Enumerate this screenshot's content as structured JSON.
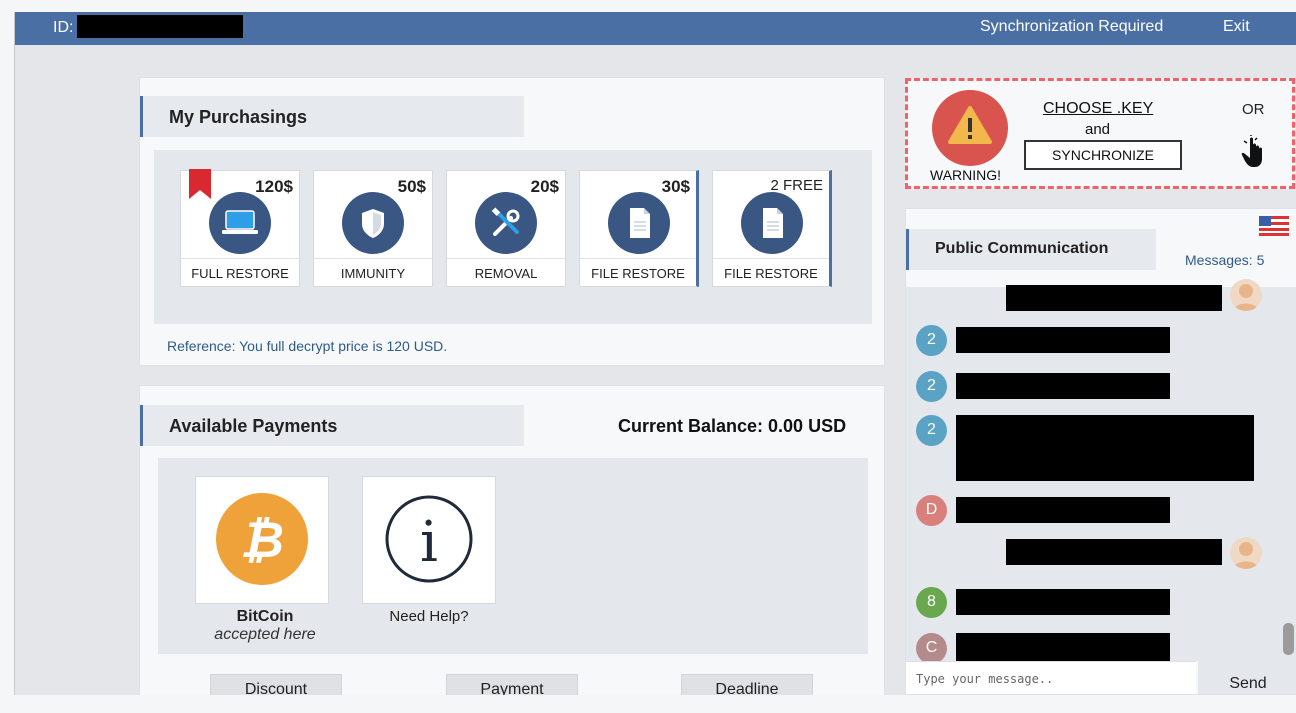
{
  "topbar": {
    "id_label": "ID:",
    "sync_link": "Synchronization Required",
    "exit_link": "Exit"
  },
  "purchasings": {
    "title": "My Purchasings",
    "options": [
      {
        "price": "120$",
        "label": "FULL RESTORE",
        "icon": "laptop-icon"
      },
      {
        "price": "50$",
        "label": "IMMUNITY",
        "icon": "shield-icon"
      },
      {
        "price": "20$",
        "label": "REMOVAL",
        "icon": "tools-icon"
      },
      {
        "price": "30$",
        "label": "FILE RESTORE",
        "icon": "document-icon"
      },
      {
        "price": "2 FREE",
        "label": "FILE RESTORE",
        "icon": "document-icon"
      }
    ],
    "reference": "Reference: You full decrypt price is 120 USD."
  },
  "payments": {
    "title": "Available Payments",
    "balance": "Current Balance: 0.00 USD",
    "methods": [
      {
        "name": "BitCoin",
        "sub": "accepted here",
        "icon": "bitcoin-icon"
      },
      {
        "name": "Need Help?",
        "icon": "info-icon"
      }
    ],
    "tabs": [
      "Discount",
      "Payment",
      "Deadline"
    ]
  },
  "warning": {
    "label": "WARNING!",
    "choose_key": "CHOOSE .KEY",
    "and": "and",
    "synchronize": "SYNCHRONIZE",
    "or": "OR"
  },
  "chat": {
    "title": "Public Communication",
    "messages_count": "Messages: 5",
    "avatars": [
      {
        "letter": "2",
        "color": "#5ba3c4"
      },
      {
        "letter": "2",
        "color": "#5ba3c4"
      },
      {
        "letter": "2",
        "color": "#5ba3c4"
      },
      {
        "letter": "D",
        "color": "#d9807c"
      },
      {
        "letter": "8",
        "color": "#6aa84f"
      },
      {
        "letter": "C",
        "color": "#b48a8a"
      }
    ],
    "input_placeholder": "Type your message..",
    "send": "Send"
  },
  "colors": {
    "accent": "#4a6fa5",
    "icon_circle": "#3a5683",
    "warning": "#d9534f",
    "bitcoin": "#f0a23a"
  }
}
